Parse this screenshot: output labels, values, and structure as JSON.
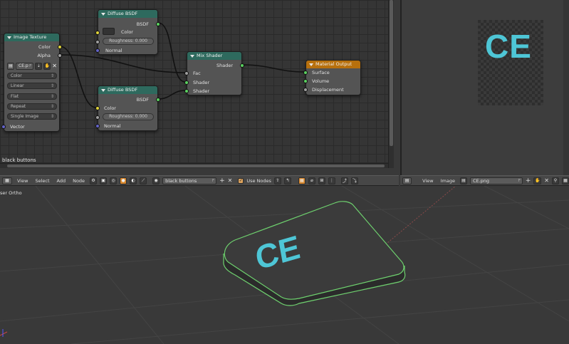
{
  "node_editor": {
    "material_name": "black buttons",
    "nodes": {
      "image_texture": {
        "title": "Image Texture",
        "out_color": "Color",
        "out_alpha": "Alpha",
        "image_name": "CE.p",
        "image_flag": "F",
        "color_space": "Color",
        "interpolation": "Linear",
        "projection": "Flat",
        "extension": "Repeat",
        "source": "Single Image",
        "in_vector": "Vector"
      },
      "diffuse_top": {
        "title": "Diffuse BSDF",
        "out_bsdf": "BSDF",
        "in_color": "Color",
        "roughness": "Roughness:  0.000",
        "in_normal": "Normal"
      },
      "diffuse_bottom": {
        "title": "Diffuse BSDF",
        "out_bsdf": "BSDF",
        "in_color": "Color",
        "roughness": "Roughness:  0.000",
        "in_normal": "Normal"
      },
      "mix_shader": {
        "title": "Mix Shader",
        "out_shader": "Shader",
        "in_fac": "Fac",
        "in_shader1": "Shader",
        "in_shader2": "Shader"
      },
      "material_output": {
        "title": "Material Output",
        "in_surface": "Surface",
        "in_volume": "Volume",
        "in_displacement": "Displacement"
      }
    }
  },
  "node_header": {
    "menus": [
      "View",
      "Select",
      "Add",
      "Node"
    ],
    "material_field": "black buttons",
    "material_flag": "F",
    "use_nodes_label": "Use Nodes"
  },
  "image_editor": {
    "preview_text": "CE",
    "header_menus": [
      "View",
      "Image"
    ],
    "image_field": "CE.png",
    "image_flag": "F"
  },
  "viewport": {
    "label": "ser Ortho",
    "key_text": "CE"
  },
  "colors": {
    "node_header_teal": "#2e6a5e",
    "node_header_orange": "#b7700d",
    "socket_yellow": "#e0d43a",
    "socket_green": "#5bd160",
    "socket_gray": "#a0a0a0",
    "socket_blue": "#6363c7",
    "ce_text": "#4ec6d6",
    "selection_outline": "#6ed16e"
  }
}
